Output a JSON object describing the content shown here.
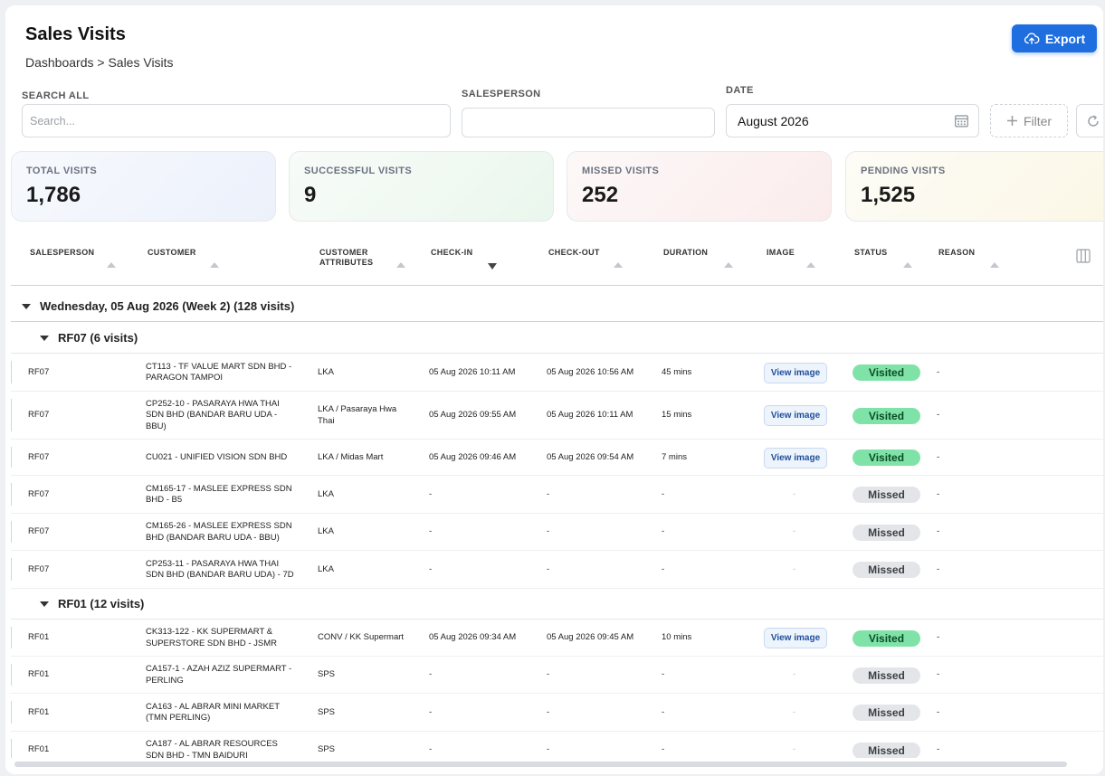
{
  "page": {
    "title": "Sales Visits",
    "breadcrumb": "Dashboards > Sales Visits",
    "export_label": "Export"
  },
  "filters": {
    "search_label": "SEARCH ALL",
    "search_placeholder": "Search...",
    "salesperson_label": "SALESPERSON",
    "salesperson_value": "",
    "date_label": "DATE",
    "date_value": "August 2026",
    "filter_label": "Filter"
  },
  "stats": [
    {
      "label": "TOTAL VISITS",
      "value": "1,786"
    },
    {
      "label": "SUCCESSFUL VISITS",
      "value": "9"
    },
    {
      "label": "MISSED VISITS",
      "value": "252"
    },
    {
      "label": "PENDING VISITS",
      "value": "1,525"
    }
  ],
  "columns": [
    {
      "line1": "SALESPERSON",
      "line2": ""
    },
    {
      "line1": "CUSTOMER",
      "line2": ""
    },
    {
      "line1": "CUSTOMER",
      "line2": "ATTRIBUTES"
    },
    {
      "line1": "CHECK-IN",
      "line2": ""
    },
    {
      "line1": "CHECK-OUT",
      "line2": ""
    },
    {
      "line1": "DURATION",
      "line2": ""
    },
    {
      "line1": "IMAGE",
      "line2": ""
    },
    {
      "line1": "STATUS",
      "line2": ""
    },
    {
      "line1": "REASON",
      "line2": ""
    }
  ],
  "day_group": "Wednesday, 05 Aug 2026 (Week 2) (128 visits)",
  "groups": [
    {
      "label": "RF07 (6 visits)",
      "rows": [
        {
          "salesperson": "RF07",
          "customer": [
            "CT113 - TF VALUE MART SDN BHD -",
            "PARAGON TAMPOI"
          ],
          "attributes": [
            "LKA"
          ],
          "check_in": "05 Aug 2026 10:11 AM",
          "check_out": "05 Aug 2026 10:56 AM",
          "duration": "45 mins",
          "image": "View image",
          "status": "Visited",
          "reason": "-"
        },
        {
          "salesperson": "RF07",
          "customer": [
            "CP252-10 - PASARAYA HWA THAI",
            "SDN BHD (BANDAR BARU UDA -",
            "BBU)"
          ],
          "attributes": [
            "LKA / Pasaraya Hwa",
            "Thai"
          ],
          "check_in": "05 Aug 2026 09:55 AM",
          "check_out": "05 Aug 2026 10:11 AM",
          "duration": "15 mins",
          "image": "View image",
          "status": "Visited",
          "reason": "-"
        },
        {
          "salesperson": "RF07",
          "customer": [
            "CU021 - UNIFIED VISION SDN BHD"
          ],
          "attributes": [
            "LKA / Midas Mart"
          ],
          "check_in": "05 Aug 2026 09:46 AM",
          "check_out": "05 Aug 2026 09:54 AM",
          "duration": "7 mins",
          "image": "View image",
          "status": "Visited",
          "reason": "-"
        },
        {
          "salesperson": "RF07",
          "customer": [
            "CM165-17 - MASLEE EXPRESS SDN",
            "BHD - B5"
          ],
          "attributes": [
            "LKA"
          ],
          "check_in": "-",
          "check_out": "-",
          "duration": "-",
          "image": "-",
          "status": "Missed",
          "reason": "-"
        },
        {
          "salesperson": "RF07",
          "customer": [
            "CM165-26 - MASLEE EXPRESS SDN",
            "BHD (BANDAR BARU UDA - BBU)"
          ],
          "attributes": [
            "LKA"
          ],
          "check_in": "-",
          "check_out": "-",
          "duration": "-",
          "image": "-",
          "status": "Missed",
          "reason": "-"
        },
        {
          "salesperson": "RF07",
          "customer": [
            "CP253-11 - PASARAYA HWA THAI",
            "SDN BHD (BANDAR BARU UDA) - 7D"
          ],
          "attributes": [
            "LKA"
          ],
          "check_in": "-",
          "check_out": "-",
          "duration": "-",
          "image": "-",
          "status": "Missed",
          "reason": "-"
        }
      ]
    },
    {
      "label": "RF01 (12 visits)",
      "rows": [
        {
          "salesperson": "RF01",
          "customer": [
            "CK313-122 - KK SUPERMART &",
            "SUPERSTORE SDN BHD - JSMR"
          ],
          "attributes": [
            "CONV / KK Supermart"
          ],
          "check_in": "05 Aug 2026 09:34 AM",
          "check_out": "05 Aug 2026 09:45 AM",
          "duration": "10 mins",
          "image": "View image",
          "status": "Visited",
          "reason": "-"
        },
        {
          "salesperson": "RF01",
          "customer": [
            "CA157-1 - AZAH AZIZ SUPERMART -",
            "PERLING"
          ],
          "attributes": [
            "SPS"
          ],
          "check_in": "-",
          "check_out": "-",
          "duration": "-",
          "image": "-",
          "status": "Missed",
          "reason": "-"
        },
        {
          "salesperson": "RF01",
          "customer": [
            "CA163 - AL ABRAR MINI MARKET",
            "(TMN PERLING)"
          ],
          "attributes": [
            "SPS"
          ],
          "check_in": "-",
          "check_out": "-",
          "duration": "-",
          "image": "-",
          "status": "Missed",
          "reason": "-"
        },
        {
          "salesperson": "RF01",
          "customer": [
            "CA187 - AL ABRAR RESOURCES",
            "SDN BHD - TMN BAIDURI"
          ],
          "attributes": [
            "SPS"
          ],
          "check_in": "-",
          "check_out": "-",
          "duration": "-",
          "image": "-",
          "status": "Missed",
          "reason": "-"
        }
      ]
    }
  ]
}
